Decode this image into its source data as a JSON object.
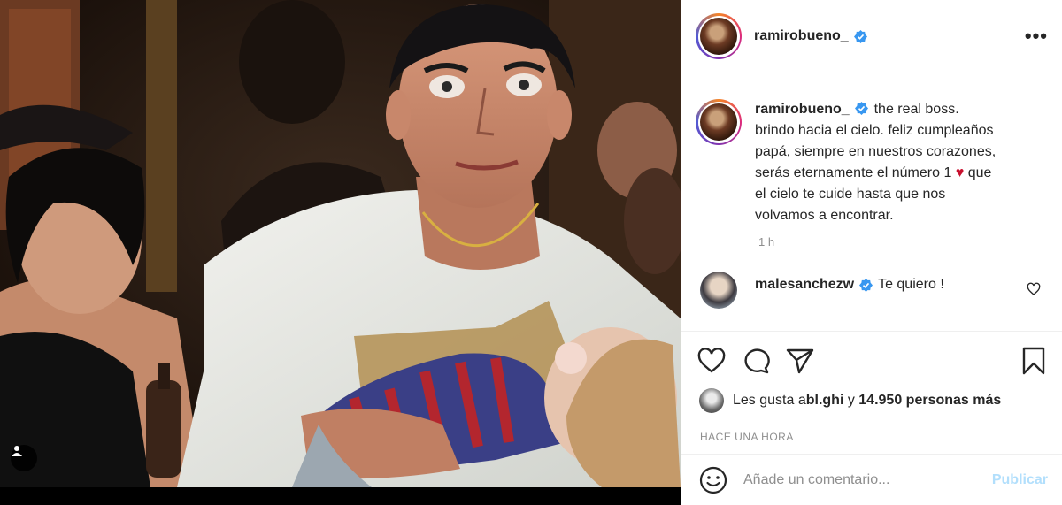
{
  "post": {
    "author": "ramirobueno_",
    "more_label": "•••",
    "caption_lines": [
      "the real boss.",
      "brindo hacia el cielo. feliz cumpleaños",
      "papá, siempre en nuestros corazones,",
      "serás eternamente el número 1",
      "que",
      "el cielo te cuide hasta que nos",
      "volvamos a encontrar."
    ],
    "caption_heart": "♥",
    "caption_time": "1 h"
  },
  "comment": {
    "author": "malesanchezw",
    "text": "Te quiero !"
  },
  "likes": {
    "prefix": "Les gusta a ",
    "user": "bl.ghi",
    "middle": " y ",
    "count": "14.950 personas más"
  },
  "timestamp": "HACE UNA HORA",
  "comment_box": {
    "placeholder": "Añade un comentario...",
    "publish_label": "Publicar"
  },
  "colors": {
    "verified": "#3897f0",
    "publish_disabled": "#b2dffc",
    "heart": "#c8102e"
  }
}
